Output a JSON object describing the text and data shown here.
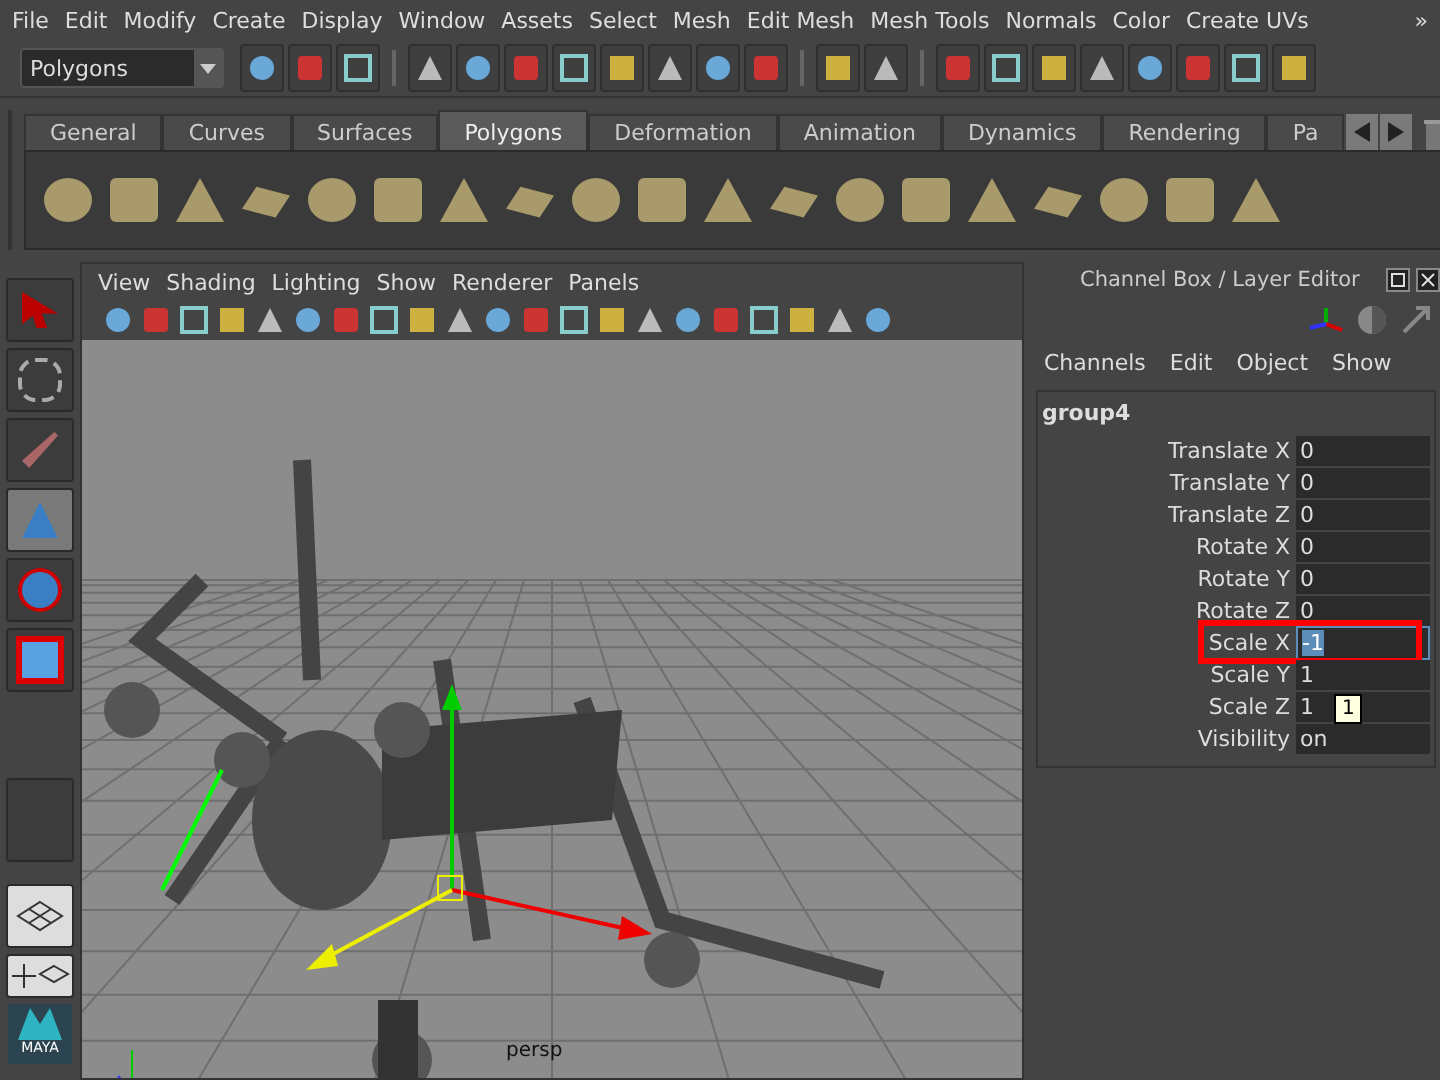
{
  "menu_bar": {
    "items": [
      "File",
      "Edit",
      "Modify",
      "Create",
      "Display",
      "Window",
      "Assets",
      "Select",
      "Mesh",
      "Edit Mesh",
      "Mesh Tools",
      "Normals",
      "Color",
      "Create UVs"
    ],
    "overflow": "»"
  },
  "status_line": {
    "mode": "Polygons"
  },
  "shelf": {
    "tabs": [
      {
        "label": "General",
        "selected": false
      },
      {
        "label": "Curves",
        "selected": false
      },
      {
        "label": "Surfaces",
        "selected": false
      },
      {
        "label": "Polygons",
        "selected": true
      },
      {
        "label": "Deformation",
        "selected": false
      },
      {
        "label": "Animation",
        "selected": false
      },
      {
        "label": "Dynamics",
        "selected": false
      },
      {
        "label": "Rendering",
        "selected": false
      },
      {
        "label": "Pa",
        "selected": false
      }
    ]
  },
  "viewport": {
    "menu": [
      "View",
      "Shading",
      "Lighting",
      "Show",
      "Renderer",
      "Panels"
    ],
    "camera": "persp"
  },
  "channel_box": {
    "title": "Channel Box / Layer Editor",
    "menu": [
      "Channels",
      "Edit",
      "Object",
      "Show"
    ],
    "object": "group4",
    "channels": [
      {
        "name": "Translate X",
        "value": "0",
        "editing": false,
        "highlighted": false
      },
      {
        "name": "Translate Y",
        "value": "0",
        "editing": false,
        "highlighted": false
      },
      {
        "name": "Translate Z",
        "value": "0",
        "editing": false,
        "highlighted": false
      },
      {
        "name": "Rotate X",
        "value": "0",
        "editing": false,
        "highlighted": false
      },
      {
        "name": "Rotate Y",
        "value": "0",
        "editing": false,
        "highlighted": false
      },
      {
        "name": "Rotate Z",
        "value": "0",
        "editing": false,
        "highlighted": false
      },
      {
        "name": "Scale X",
        "value": "-1",
        "editing": true,
        "highlighted": true
      },
      {
        "name": "Scale Y",
        "value": "1",
        "editing": false,
        "highlighted": false
      },
      {
        "name": "Scale Z",
        "value": "1",
        "editing": false,
        "highlighted": false
      },
      {
        "name": "Visibility",
        "value": "on",
        "editing": false,
        "highlighted": false
      }
    ],
    "tooltip": "1"
  },
  "logo": "MAYA"
}
